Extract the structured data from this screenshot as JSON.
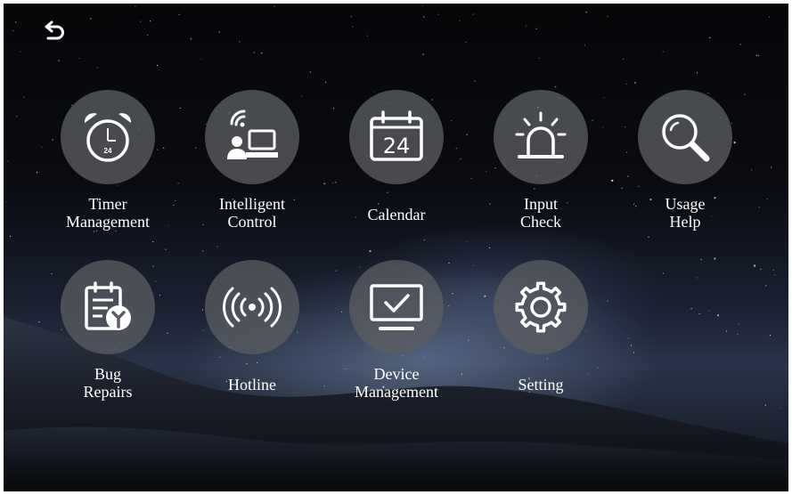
{
  "top_bar": {
    "back_icon": "back-arrow-icon"
  },
  "tiles": [
    {
      "id": "timer-management",
      "icon": "alarm-clock-icon",
      "line1": "Timer",
      "line2": "Management",
      "badge": "24"
    },
    {
      "id": "intelligent-control",
      "icon": "remote-computer-icon",
      "line1": "Intelligent",
      "line2": "Control"
    },
    {
      "id": "calendar",
      "icon": "calendar-icon",
      "line1": "Calendar",
      "badge": "24"
    },
    {
      "id": "input-check",
      "icon": "alarm-siren-icon",
      "line1": "Input",
      "line2": "Check"
    },
    {
      "id": "usage-help",
      "icon": "magnifier-icon",
      "line1": "Usage",
      "line2": "Help"
    },
    {
      "id": "bug-repairs",
      "icon": "repair-clipboard-icon",
      "line1": "Bug",
      "line2": "Repairs"
    },
    {
      "id": "hotline",
      "icon": "broadcast-signal-icon",
      "line1": "Hotline"
    },
    {
      "id": "device-management",
      "icon": "monitor-check-icon",
      "line1": "Device",
      "line2": "Management"
    },
    {
      "id": "setting",
      "icon": "gear-icon",
      "line1": "Setting"
    }
  ],
  "colors": {
    "circle": "#5a5c62",
    "text": "#ffffff",
    "sky": "#050608"
  }
}
